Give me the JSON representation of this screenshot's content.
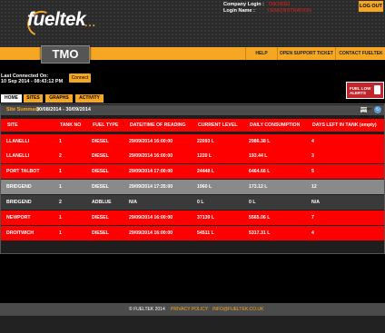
{
  "header": {
    "logo_text": "fueltek",
    "logo_dots": "...",
    "company_login_label": "Company Login :",
    "company_login_value": "TMOIIDEI",
    "login_name_label": "Login Name :",
    "login_name_value": "DEMONSTRATION",
    "logout_label": "LOG OUT"
  },
  "nav": {
    "section_title": "TMO",
    "links": [
      "HELP",
      "OPEN SUPPORT TICKET",
      "CONTACT FUELTEK"
    ]
  },
  "connection": {
    "label": "Last Connected On:",
    "value": "10 Sep 2014 - 08:43:12 PM",
    "connect_label": "Connect"
  },
  "alert": {
    "label_line1": "FUEL LOW",
    "label_line2": "ALERTS",
    "icon": "fuel-pump-icon"
  },
  "tabs": [
    {
      "label": "HOME",
      "active": true
    },
    {
      "label": "SITES",
      "active": false
    },
    {
      "label": "GRAPHS",
      "active": false
    },
    {
      "label": "ACTIVITY",
      "active": false
    }
  ],
  "summary": {
    "label": "Site Summary",
    "range": "30/08/2014 - 30/09/2014",
    "export_label": "EXPORT TO EXCEL"
  },
  "table": {
    "headers": [
      "SITE",
      "TANK NO",
      "FUEL TYPE",
      "DATE/TIME OF READING",
      "CURRENT LEVEL",
      "DAILY CONSUMPTION",
      "DAYS LEFT IN TANK (empty)"
    ],
    "rows": [
      {
        "site": "LLANELLI",
        "tank": "1",
        "fuel": "DIESEL",
        "datetime": "29/09/2014 16:00:00",
        "level": "22093 L",
        "consumption": "2986.38 L",
        "days": "4",
        "status": "low"
      },
      {
        "site": "LLANELLI",
        "tank": "2",
        "fuel": "DIESEL",
        "datetime": "29/09/2014 16:00:00",
        "level": "1220 L",
        "consumption": "193.44 L",
        "days": "3",
        "status": "low"
      },
      {
        "site": "PORT TALBOT",
        "tank": "1",
        "fuel": "DIESEL",
        "datetime": "29/09/2014 17:00:00",
        "level": "24448 L",
        "consumption": "6464.66 L",
        "days": "5",
        "status": "low"
      },
      {
        "site": "BRIDGEND",
        "tank": "1",
        "fuel": "DIESEL",
        "datetime": "29/09/2014 17:35:00",
        "level": "1960 L",
        "consumption": "173.12 L",
        "days": "12",
        "status": "ok"
      },
      {
        "site": "BRIDGEND",
        "tank": "2",
        "fuel": "ADBLUE",
        "datetime": "N/A",
        "level": "0 L",
        "consumption": "0 L",
        "days": "N/A",
        "status": "none"
      },
      {
        "site": "NEWPORT",
        "tank": "1",
        "fuel": "DIESEL",
        "datetime": "29/09/2014 16:00:00",
        "level": "37139 L",
        "consumption": "5565.06 L",
        "days": "7",
        "status": "low"
      },
      {
        "site": "DROITWICH",
        "tank": "1",
        "fuel": "DIESEL",
        "datetime": "29/09/2014 16:00:00",
        "level": "54511 L",
        "consumption": "5317.31 L",
        "days": "4",
        "status": "low"
      }
    ]
  },
  "footer": {
    "copyright": "© FUELTEK 2014",
    "privacy": "PRIVACY POLICY",
    "email": "INFO@FUELTEK.CO.UK"
  },
  "colors": {
    "accent": "#f5a623",
    "low": "#ff0000",
    "ok": "#8a8a8a",
    "none": "#3a3a3a"
  }
}
